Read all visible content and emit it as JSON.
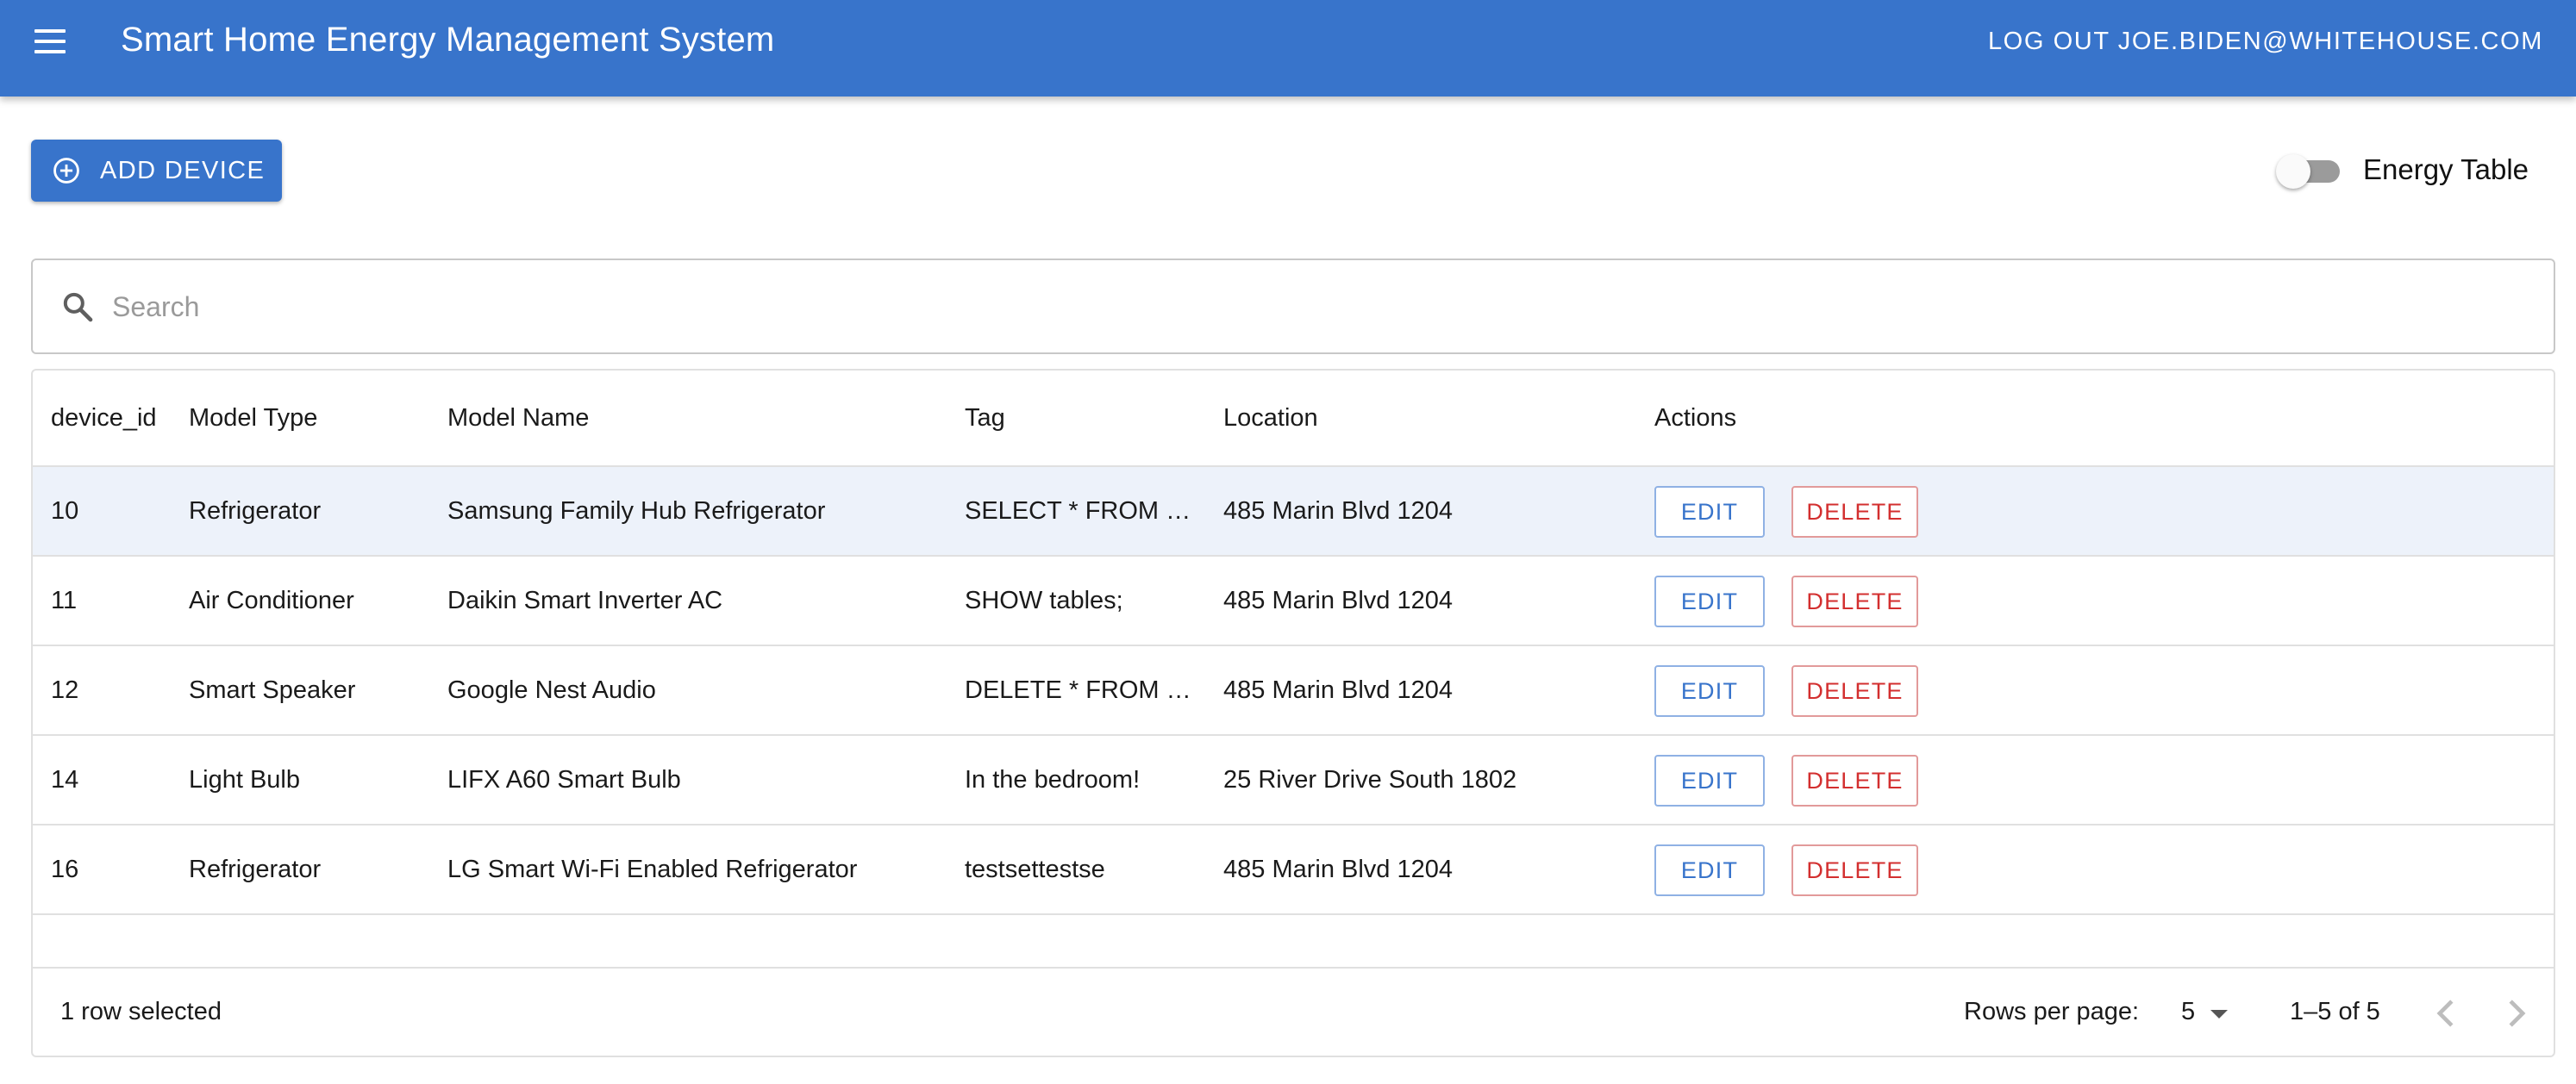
{
  "app": {
    "title": "Smart Home Energy Management System",
    "logout_label": "LOG OUT JOE.BIDEN@WHITEHOUSE.COM",
    "menu_icon": "menu-icon",
    "colors": {
      "primary": "#3874CB",
      "danger": "#d32f2f",
      "selected_row": "#EDF2FA"
    }
  },
  "toolbar": {
    "add_device_label": "ADD DEVICE",
    "add_device_icon": "add-circle-icon",
    "toggle_label": "Energy Table",
    "toggle_on": false
  },
  "search": {
    "placeholder": "Search",
    "value": "",
    "icon": "search-icon"
  },
  "table": {
    "columns": [
      "device_id",
      "Model Type",
      "Model Name",
      "Tag",
      "Location",
      "Actions"
    ],
    "rows": [
      {
        "id": "10",
        "type": "Refrigerator",
        "name": "Samsung Family Hub Refrigerator",
        "tag": "SELECT * FROM …",
        "location": "485 Marin Blvd 1204",
        "selected": true
      },
      {
        "id": "11",
        "type": "Air Conditioner",
        "name": "Daikin Smart Inverter AC",
        "tag": "SHOW tables;",
        "location": "485 Marin Blvd 1204",
        "selected": false
      },
      {
        "id": "12",
        "type": "Smart Speaker",
        "name": "Google Nest Audio",
        "tag": "DELETE * FROM …",
        "location": "485 Marin Blvd 1204",
        "selected": false
      },
      {
        "id": "14",
        "type": "Light Bulb",
        "name": "LIFX A60 Smart Bulb",
        "tag": "In the bedroom!",
        "location": "25 River Drive South 1802",
        "selected": false
      },
      {
        "id": "16",
        "type": "Refrigerator",
        "name": "LG Smart Wi-Fi Enabled Refrigerator",
        "tag": "testsettestse",
        "location": "485 Marin Blvd 1204",
        "selected": false
      }
    ],
    "edit_label": "EDIT",
    "delete_label": "DELETE"
  },
  "footer": {
    "selected_text": "1 row selected",
    "rows_per_page_label": "Rows per page:",
    "rows_per_page_value": "5",
    "range_text": "1–5 of 5",
    "prev_icon": "chevron-left-icon",
    "next_icon": "chevron-right-icon"
  }
}
